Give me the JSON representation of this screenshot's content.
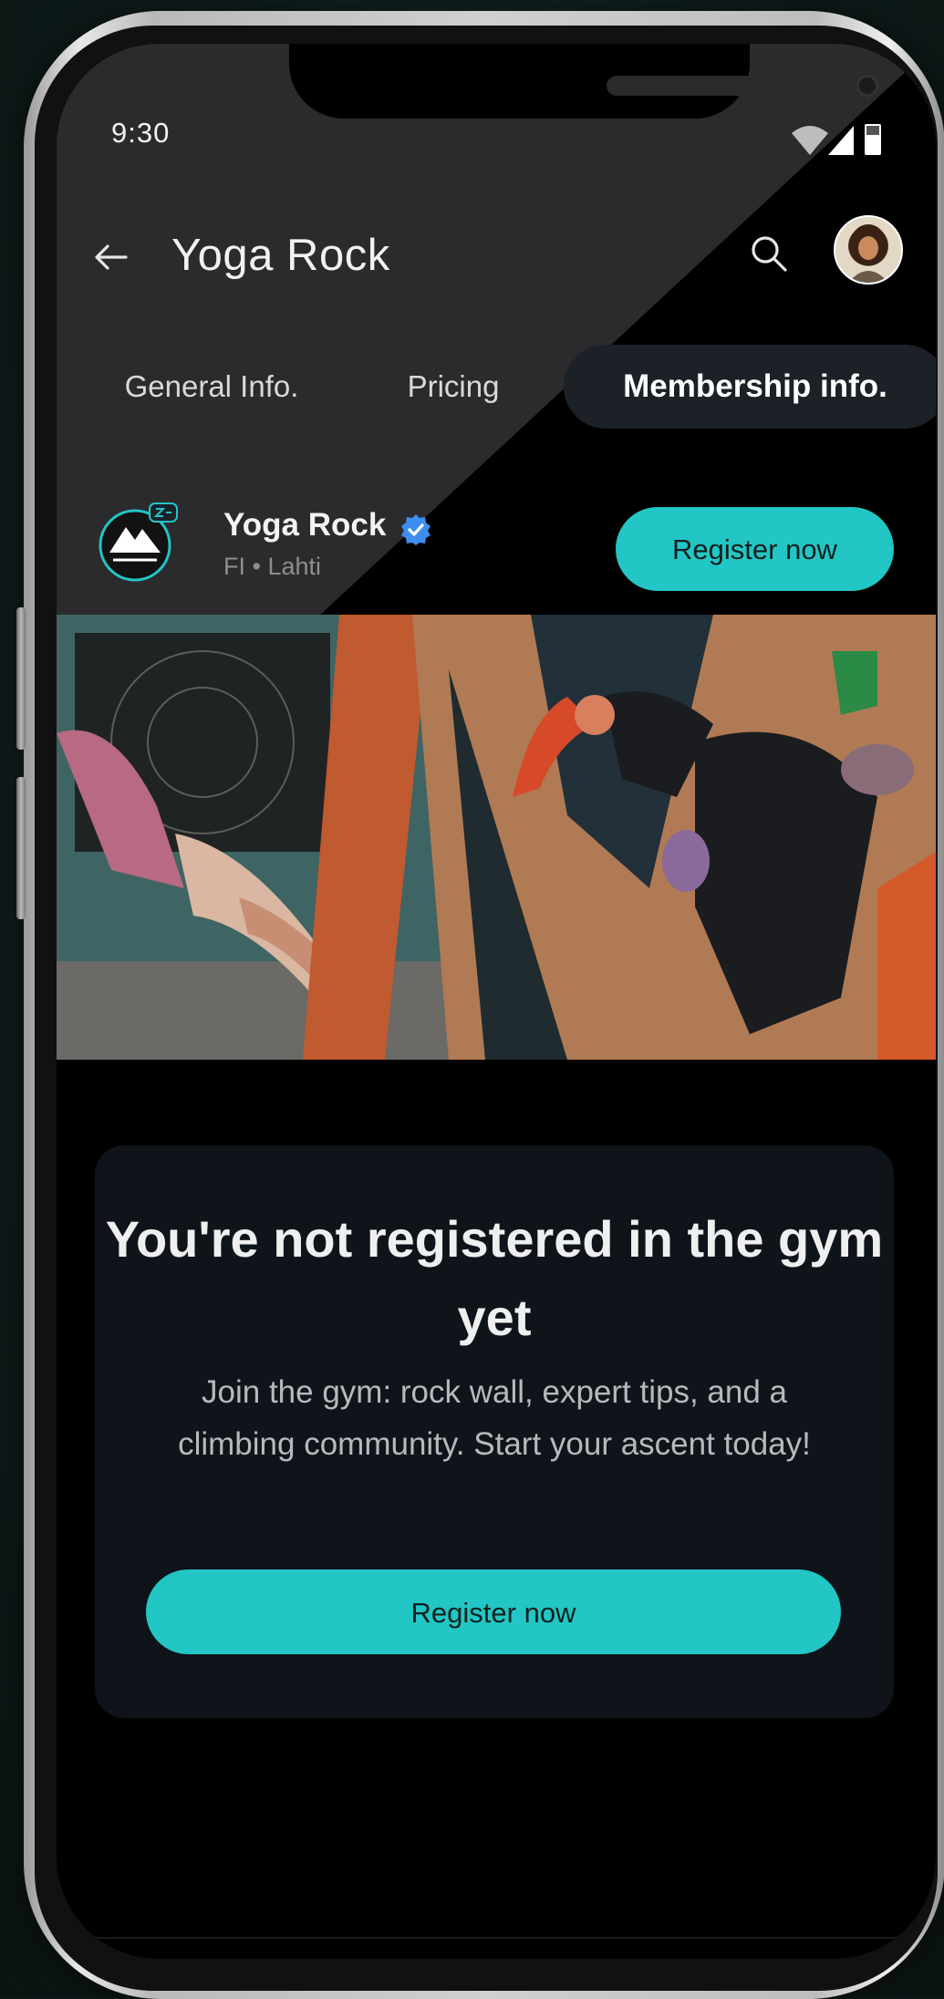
{
  "status_bar": {
    "time": "9:30",
    "icons": [
      "wifi-icon",
      "signal-icon",
      "battery-icon"
    ]
  },
  "app_bar": {
    "back_icon": "arrow-left-icon",
    "title": "Yoga Rock",
    "search_icon": "search-icon",
    "avatar": "user-avatar"
  },
  "tabs": [
    {
      "label": "General Info.",
      "active": false
    },
    {
      "label": "Pricing",
      "active": false
    },
    {
      "label": "Membership info.",
      "active": true
    }
  ],
  "gym": {
    "name": "Yoga Rock",
    "verified": true,
    "location": "FI • Lahti",
    "logo": "yogarock-logo",
    "register_label": "Register now"
  },
  "hero": {
    "image": "yoga-and-climbing-photo"
  },
  "membership_card": {
    "title": "You're not registered in the gym yet",
    "description": "Join the gym: rock wall, expert tips, and a climbing community. Start your ascent today!",
    "register_label": "Register now"
  },
  "colors": {
    "accent": "#22c6c4",
    "header_bg": "#2b2b2d",
    "card_bg": "#0e141a",
    "screen_bg": "#000000"
  }
}
